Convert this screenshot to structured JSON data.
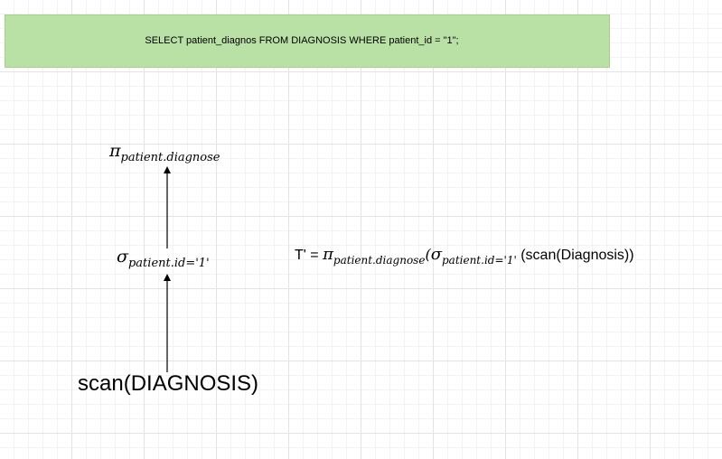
{
  "sql_query": "SELECT patient_diagnos FROM DIAGNOSIS WHERE patient_id = \"1\";",
  "tree": {
    "projection": {
      "symbol": "π",
      "subscript": "patient.diagnose"
    },
    "selection": {
      "symbol": "σ",
      "subscript": "patient.id='1'"
    },
    "scan": "scan(DIAGNOSIS)"
  },
  "expression": {
    "lhs": "T' = ",
    "pi": "π",
    "pi_sub": "patient.diagnose",
    "open_paren": "(",
    "sigma": "σ",
    "sigma_sub": "patient.id='1'",
    "scan_part": " (scan(Diagnosis))"
  },
  "colors": {
    "sql_box_fill": "#b9e0a5",
    "sql_box_border": "#a8d18f",
    "grid": "#e4e4e4"
  }
}
